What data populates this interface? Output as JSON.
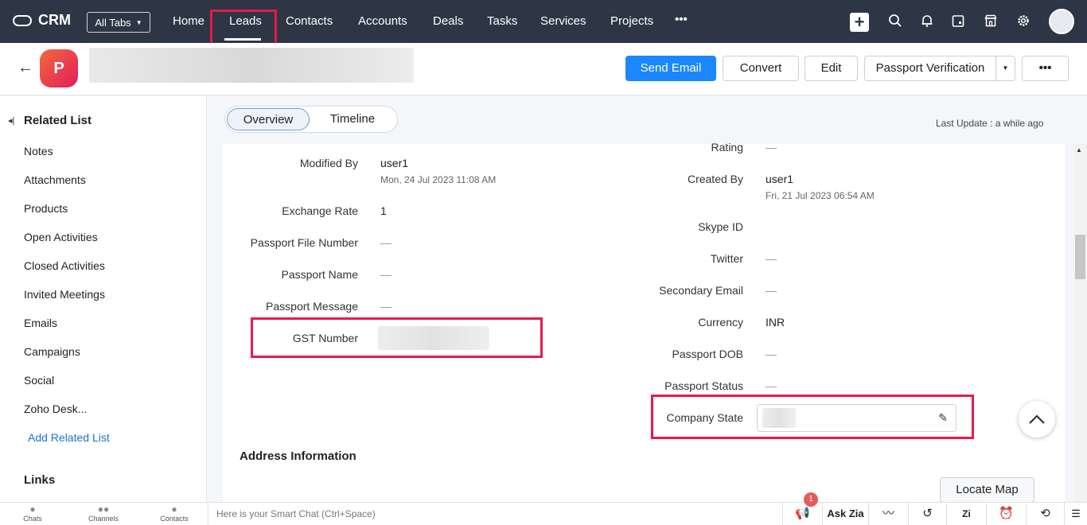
{
  "app": {
    "name": "CRM",
    "all_tabs": "All Tabs"
  },
  "nav": {
    "items": [
      "Home",
      "Leads",
      "Contacts",
      "Accounts",
      "Deals",
      "Tasks",
      "Services",
      "Projects"
    ],
    "more": "•••",
    "active": "Leads"
  },
  "top_icons": [
    "plus-icon",
    "search-icon",
    "bell-icon",
    "calendar-icon",
    "marketplace-icon",
    "gear-icon",
    "avatar"
  ],
  "record": {
    "avatar_letter": "P"
  },
  "actions": {
    "send_email": "Send Email",
    "convert": "Convert",
    "edit": "Edit",
    "passport_verification": "Passport Verification",
    "more": "•••"
  },
  "sidebar": {
    "related_title": "Related List",
    "items": [
      "Notes",
      "Attachments",
      "Products",
      "Open Activities",
      "Closed Activities",
      "Invited Meetings",
      "Emails",
      "Campaigns",
      "Social",
      "Zoho Desk..."
    ],
    "add_related": "Add Related List",
    "links_title": "Links"
  },
  "tabs": {
    "overview": "Overview",
    "timeline": "Timeline"
  },
  "last_update": "Last Update : a while ago",
  "left_fields": {
    "modified_by": {
      "label": "Modified By",
      "value": "user1",
      "sub": "Mon, 24 Jul 2023 11:08 AM"
    },
    "exchange_rate": {
      "label": "Exchange Rate",
      "value": "1"
    },
    "passport_file_number": {
      "label": "Passport File Number",
      "value": "—"
    },
    "passport_name": {
      "label": "Passport Name",
      "value": "—"
    },
    "passport_message": {
      "label": "Passport Message",
      "value": "—"
    },
    "gst_number": {
      "label": "GST Number"
    }
  },
  "right_fields": {
    "rating": {
      "label": "Rating",
      "value": "—"
    },
    "created_by": {
      "label": "Created By",
      "value": "user1",
      "sub": "Fri, 21 Jul 2023 06:54 AM"
    },
    "skype_id": {
      "label": "Skype ID"
    },
    "twitter": {
      "label": "Twitter",
      "value": "—"
    },
    "secondary_email": {
      "label": "Secondary Email",
      "value": "—"
    },
    "currency": {
      "label": "Currency",
      "value": "INR"
    },
    "passport_dob": {
      "label": "Passport DOB",
      "value": "—"
    },
    "passport_status": {
      "label": "Passport Status",
      "value": "—"
    },
    "company_state": {
      "label": "Company State"
    }
  },
  "address_section": "Address Information",
  "locate_map": "Locate Map",
  "bottom": {
    "chats": "Chats",
    "channels": "Channels",
    "contacts": "Contacts",
    "smart_chat": "Here is your Smart Chat (Ctrl+Space)",
    "ask_zia": "Ask Zia",
    "notif_count": "1"
  },
  "highlight_color": "#e8194d",
  "primary_color": "#1a87ff"
}
